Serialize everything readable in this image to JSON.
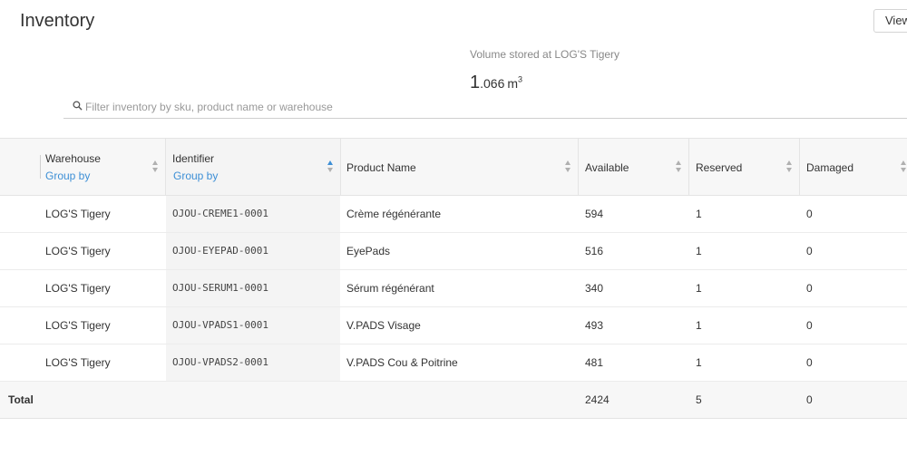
{
  "page": {
    "title": "Inventory",
    "view_button_label": "View"
  },
  "volume": {
    "label": "Volume stored at LOG'S Tigery",
    "value_int": "1",
    "value_dec": ".066",
    "unit": "m",
    "unit_power": "3"
  },
  "search": {
    "placeholder": "Filter inventory by sku, product name or warehouse",
    "value": ""
  },
  "table": {
    "columns": {
      "warehouse": {
        "title": "Warehouse",
        "group_by": "Group by"
      },
      "identifier": {
        "title": "Identifier",
        "group_by": "Group by"
      },
      "product_name": {
        "title": "Product Name"
      },
      "available": {
        "title": "Available"
      },
      "reserved": {
        "title": "Reserved"
      },
      "damaged": {
        "title": "Damaged"
      }
    },
    "rows": [
      {
        "warehouse": "LOG'S Tigery",
        "identifier": "OJOU-CREME1-0001",
        "product_name": "Crème régénérante",
        "available": "594",
        "reserved": "1",
        "damaged": "0"
      },
      {
        "warehouse": "LOG'S Tigery",
        "identifier": "OJOU-EYEPAD-0001",
        "product_name": "EyePads",
        "available": "516",
        "reserved": "1",
        "damaged": "0"
      },
      {
        "warehouse": "LOG'S Tigery",
        "identifier": "OJOU-SERUM1-0001",
        "product_name": "Sérum régénérant",
        "available": "340",
        "reserved": "1",
        "damaged": "0"
      },
      {
        "warehouse": "LOG'S Tigery",
        "identifier": "OJOU-VPADS1-0001",
        "product_name": "V.PADS Visage",
        "available": "493",
        "reserved": "1",
        "damaged": "0"
      },
      {
        "warehouse": "LOG'S Tigery",
        "identifier": "OJOU-VPADS2-0001",
        "product_name": "V.PADS Cou & Poitrine",
        "available": "481",
        "reserved": "1",
        "damaged": "0"
      }
    ],
    "total": {
      "label": "Total",
      "available": "2424",
      "reserved": "5",
      "damaged": "0"
    }
  },
  "colors": {
    "accent": "#3d8fd6",
    "header_bg": "#f7f7f7",
    "identifier_bg": "#f4f4f4"
  },
  "icons": {
    "search": "search-icon",
    "sort": "sort-icon"
  }
}
